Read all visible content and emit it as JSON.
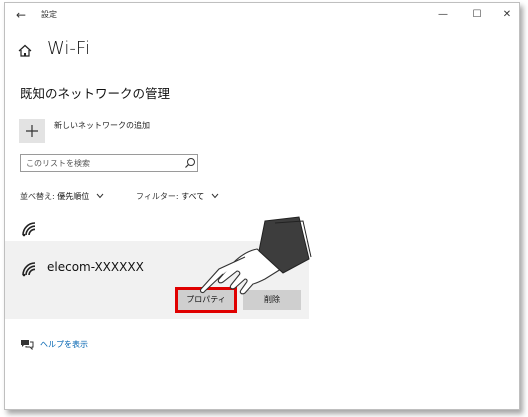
{
  "window": {
    "app_title": "設定",
    "back_icon": "←",
    "minimize_icon": "—",
    "maximize_icon": "☐",
    "close_icon": "✕"
  },
  "page": {
    "title": "Wi-Fi",
    "section_title": "既知のネットワークの管理"
  },
  "add_network": {
    "label": "新しいネットワークの追加"
  },
  "search": {
    "placeholder": "このリストを検索"
  },
  "sort": {
    "label": "並べ替え: ",
    "value": "優先順位"
  },
  "filter": {
    "label": "フィルター: ",
    "value": "すべて"
  },
  "networks": [
    {
      "name": "elecom-XXXXXX"
    }
  ],
  "actions": {
    "properties": "プロパティ",
    "delete": "削除"
  },
  "help": {
    "link": "ヘルプを表示"
  },
  "colors": {
    "highlight": "#e00000",
    "link": "#0063b1",
    "selected_panel": "#f1f1f1",
    "button": "#cfcfcf"
  }
}
